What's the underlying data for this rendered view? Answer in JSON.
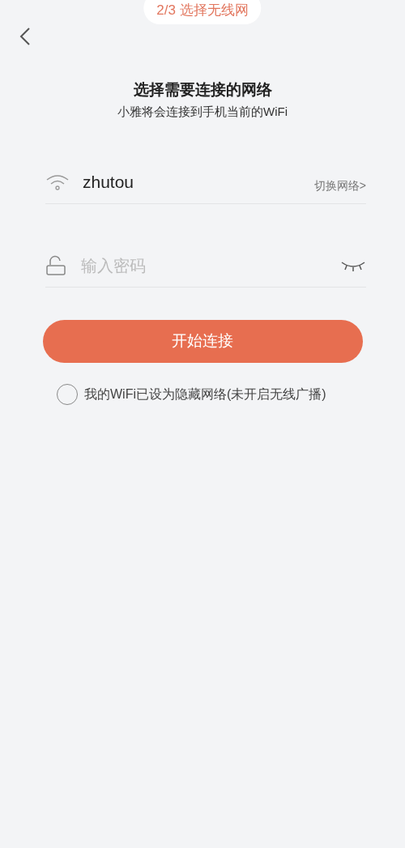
{
  "step_label": "2/3 选择无线网",
  "heading": {
    "title": "选择需要连接的网络",
    "subtitle": "小雅将会连接到手机当前的WiFi"
  },
  "network": {
    "ssid": "zhutou",
    "switch_link": "切换网络>"
  },
  "password": {
    "placeholder": "输入密码",
    "visible": false
  },
  "connect_button": "开始连接",
  "hidden_network": {
    "label": "我的WiFi已设为隐藏网络(未开启无线广播)",
    "checked": false
  }
}
